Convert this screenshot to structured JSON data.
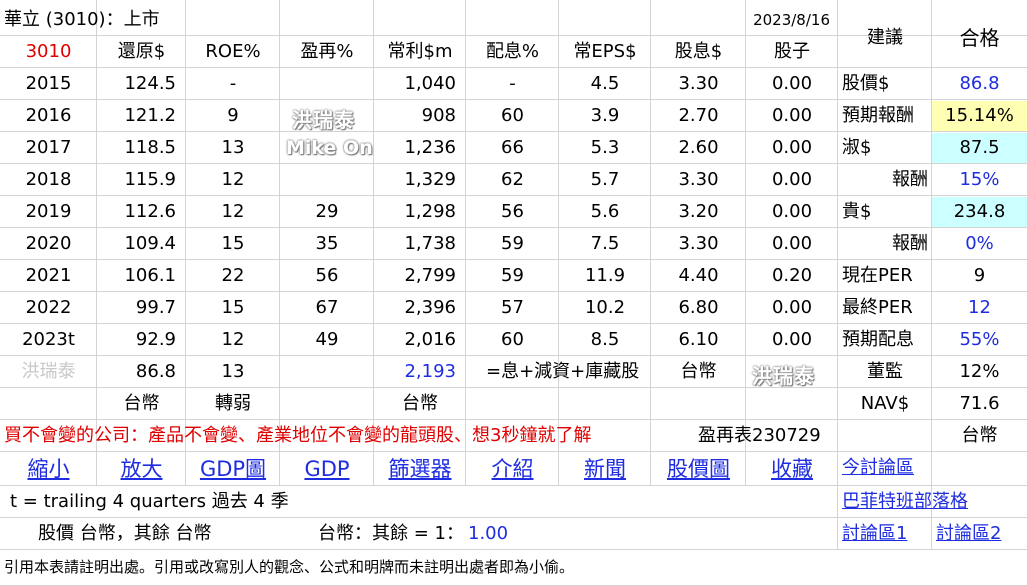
{
  "header": {
    "title": "華立 (3010)：上市",
    "date": "2023/8/16",
    "advice_label": "建議",
    "pass_label": "合格"
  },
  "columns": {
    "code": "3010",
    "restored": "還原$",
    "roe": "ROE%",
    "reinvest": "盈再%",
    "profit": "常利$m",
    "payout": "配息%",
    "eps": "常EPS$",
    "div": "股息$",
    "stockdiv": "股子"
  },
  "rows": [
    {
      "year": "2015",
      "restored": "124.5",
      "roe": "-",
      "reinvest": "",
      "profit": "1,040",
      "payout": "-",
      "eps": "4.5",
      "div": "3.30",
      "stockdiv": "0.00"
    },
    {
      "year": "2016",
      "restored": "121.2",
      "roe": "9",
      "reinvest": "",
      "profit": "908",
      "payout": "60",
      "eps": "3.9",
      "div": "2.70",
      "stockdiv": "0.00"
    },
    {
      "year": "2017",
      "restored": "118.5",
      "roe": "13",
      "reinvest": "",
      "profit": "1,236",
      "payout": "66",
      "eps": "5.3",
      "div": "2.60",
      "stockdiv": "0.00"
    },
    {
      "year": "2018",
      "restored": "115.9",
      "roe": "12",
      "reinvest": "",
      "profit": "1,329",
      "payout": "62",
      "eps": "5.7",
      "div": "3.30",
      "stockdiv": "0.00"
    },
    {
      "year": "2019",
      "restored": "112.6",
      "roe": "12",
      "reinvest": "29",
      "profit": "1,298",
      "payout": "56",
      "eps": "5.6",
      "div": "3.20",
      "stockdiv": "0.00"
    },
    {
      "year": "2020",
      "restored": "109.4",
      "roe": "15",
      "reinvest": "35",
      "profit": "1,738",
      "payout": "59",
      "eps": "7.5",
      "div": "3.30",
      "stockdiv": "0.00"
    },
    {
      "year": "2021",
      "restored": "106.1",
      "roe": "22",
      "reinvest": "56",
      "profit": "2,799",
      "payout": "59",
      "eps": "11.9",
      "div": "4.40",
      "stockdiv": "0.20"
    },
    {
      "year": "2022",
      "restored": "99.7",
      "roe": "15",
      "reinvest": "67",
      "profit": "2,396",
      "payout": "57",
      "eps": "10.2",
      "div": "6.80",
      "stockdiv": "0.00"
    },
    {
      "year": "2023t",
      "restored": "92.9",
      "roe": "12",
      "reinvest": "49",
      "profit": "2,016",
      "payout": "60",
      "eps": "8.5",
      "div": "6.10",
      "stockdiv": "0.00"
    }
  ],
  "summary": {
    "author": "洪瑞泰",
    "restored": "86.8",
    "roe": "13",
    "profit": "2,193",
    "div_note": "=息+減資+庫藏股",
    "currency": "台幣",
    "unit_restored": "台幣",
    "roe_note": "轉弱",
    "unit_profit": "台幣"
  },
  "side": [
    {
      "label": "股價$",
      "value": "86.8",
      "value_color": "blue",
      "bg": ""
    },
    {
      "label": "預期報酬",
      "value": "15.14%",
      "value_color": "black",
      "bg": "yellow"
    },
    {
      "label": "淑$",
      "value": "87.5",
      "value_color": "black",
      "bg": "cyan"
    },
    {
      "label": "報酬",
      "value": "15%",
      "value_color": "blue",
      "bg": ""
    },
    {
      "label": "貴$",
      "value": "234.8",
      "value_color": "black",
      "bg": "cyan"
    },
    {
      "label": "報酬",
      "value": "0%",
      "value_color": "blue",
      "bg": ""
    },
    {
      "label": "現在PER",
      "value": "9",
      "value_color": "black",
      "bg": ""
    },
    {
      "label": "最終PER",
      "value": "12",
      "value_color": "blue",
      "bg": ""
    },
    {
      "label": "預期配息",
      "value": "55%",
      "value_color": "blue",
      "bg": ""
    },
    {
      "label": "董監",
      "value": "12%",
      "value_color": "black",
      "bg": ""
    },
    {
      "label": "NAV$",
      "value": "71.6",
      "value_color": "black",
      "bg": ""
    },
    {
      "label": "",
      "value": "台幣",
      "value_color": "black",
      "bg": ""
    }
  ],
  "slogan": "買不會變的公司：產品不會變、產業地位不會變的龍頭股、想3秒鐘就了解",
  "table_ref": "盈再表230729",
  "links": [
    "縮小",
    "放大",
    "GDP圖",
    "GDP",
    "篩選器",
    "介紹",
    "新聞",
    "股價圖",
    "收藏"
  ],
  "side_links": {
    "today": "今討論區",
    "blog": "巴菲特班部落格",
    "forum1": "討論區1",
    "forum2": "討論區2"
  },
  "notes": {
    "trailing": "t = trailing 4 quarters 過去 4 季",
    "currency_line": "股價 台幣，其餘 台幣",
    "rate_label": "台幣：其餘 = 1：",
    "rate_value": "1.00",
    "footer": "引用本表請註明出處。引用或改寫別人的觀念、公式和明牌而未註明出處者即為小偷。"
  },
  "watermarks": {
    "cn": "洪瑞泰",
    "en": "Mike On"
  }
}
